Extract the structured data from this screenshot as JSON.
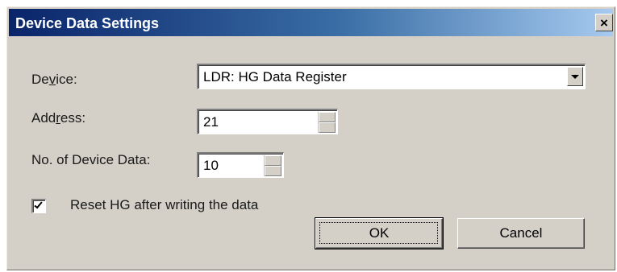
{
  "dialog": {
    "title": "Device Data Settings",
    "close_glyph": "×"
  },
  "device": {
    "label_pre": "De",
    "label_accel": "v",
    "label_post": "ice:",
    "selected": "LDR: HG Data Register"
  },
  "address": {
    "label_pre": "Add",
    "label_accel": "r",
    "label_post": "ess:",
    "value": "21"
  },
  "count": {
    "label": "No. of Device Data:",
    "value": "10"
  },
  "reset_checkbox": {
    "label": "Reset HG after writing the data",
    "checked": true
  },
  "buttons": {
    "ok": "OK",
    "cancel": "Cancel"
  }
}
